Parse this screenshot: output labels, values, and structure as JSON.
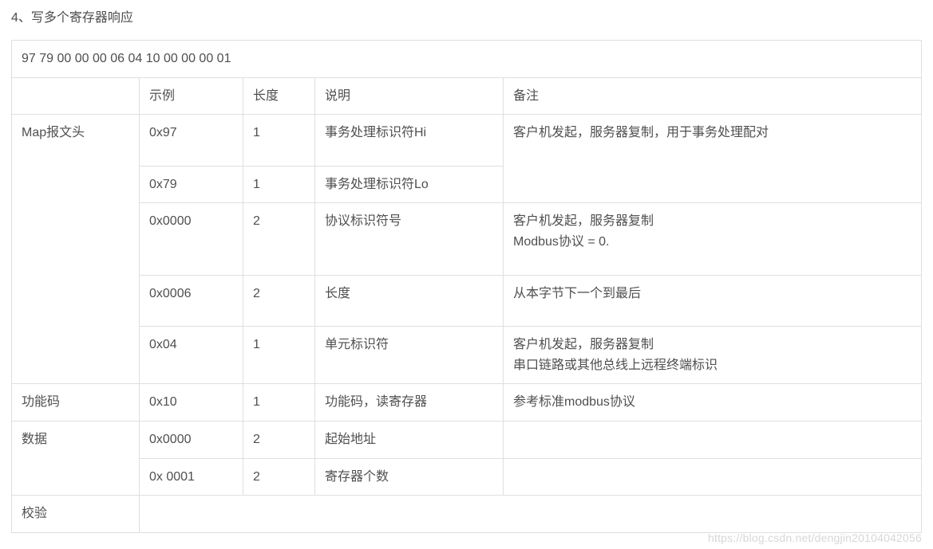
{
  "title": "4、写多个寄存器响应",
  "raw_bytes": "97 79 00 00 00 06 04 10 00 00 00 01",
  "headers": {
    "c0": "",
    "c1": "示例",
    "c2": "长度",
    "c3": "说明",
    "c4": "备注"
  },
  "map": {
    "label": "Map报文头",
    "r1": {
      "ex": "0x97",
      "len": "1",
      "desc": "事务处理标识符Hi"
    },
    "r2": {
      "ex": "0x79",
      "len": "1",
      "desc": "事务处理标识符Lo"
    },
    "note12": "客户机发起，服务器复制，用于事务处理配对",
    "r3": {
      "ex": "0x0000",
      "len": "2",
      "desc": "协议标识符号",
      "note_a": "客户机发起，服务器复制",
      "note_b": "Modbus协议 = 0."
    },
    "r4": {
      "ex": "0x0006",
      "len": "2",
      "desc": "长度",
      "note": "从本字节下一个到最后"
    },
    "r5": {
      "ex": "0x04",
      "len": "1",
      "desc": "单元标识符",
      "note_a": "客户机发起，服务器复制",
      "note_b": "串口链路或其他总线上远程终端标识"
    }
  },
  "func": {
    "label": "功能码",
    "ex": "0x10",
    "len": "1",
    "desc": "功能码，读寄存器",
    "note": "参考标准modbus协议"
  },
  "data": {
    "label": "数据",
    "r1": {
      "ex": "0x0000",
      "len": "2",
      "desc": "起始地址",
      "note": ""
    },
    "r2": {
      "ex": "0x 0001",
      "len": "2",
      "desc": "寄存器个数",
      "note": ""
    }
  },
  "check": {
    "label": "校验"
  },
  "watermark": "https://blog.csdn.net/dengjin20104042056"
}
